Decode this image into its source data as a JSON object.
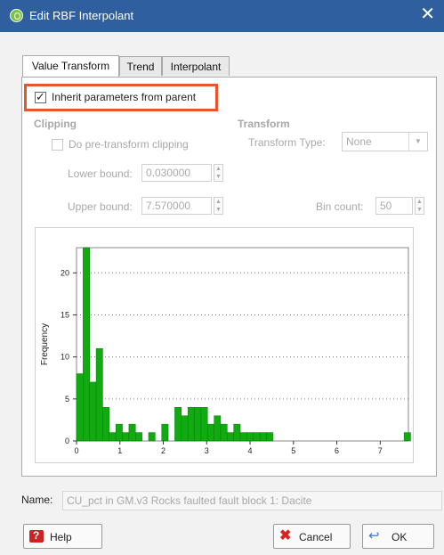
{
  "window": {
    "title": "Edit RBF Interpolant",
    "close_glyph": "✕"
  },
  "tabs": [
    "Value Transform",
    "Trend",
    "Interpolant"
  ],
  "inherit": {
    "label": "Inherit parameters from parent",
    "checked": true
  },
  "clipping": {
    "heading": "Clipping",
    "pre_transform_label": "Do pre-transform clipping",
    "lower_label": "Lower bound:",
    "lower_value": "0.030000",
    "upper_label": "Upper bound:",
    "upper_value": "7.570000"
  },
  "transform": {
    "heading": "Transform",
    "type_label": "Transform Type:",
    "type_value": "None",
    "bin_label": "Bin count:",
    "bin_value": "50"
  },
  "chart_data": {
    "type": "bar",
    "ylabel": "Frequency",
    "xlim": [
      0,
      7.65
    ],
    "ylim": [
      0,
      23
    ],
    "xticks": [
      0,
      1,
      2,
      3,
      4,
      5,
      6,
      7
    ],
    "yticks": [
      0,
      5,
      10,
      15,
      20
    ],
    "grid": "horizontal-dotted",
    "bar_color": "#11aa11",
    "bin_width": 0.151,
    "bin_starts": [
      0.0,
      0.151,
      0.302,
      0.453,
      0.604,
      0.755,
      0.906,
      1.057,
      1.208,
      1.359,
      1.51,
      1.661,
      1.812,
      1.963,
      2.114,
      2.265,
      2.416,
      2.567,
      2.718,
      2.869,
      3.02,
      3.171,
      3.322,
      3.473,
      3.624,
      3.775,
      3.926,
      4.077,
      4.228,
      4.379,
      4.53,
      7.55
    ],
    "values": [
      8,
      23,
      7,
      11,
      4,
      1,
      2,
      1,
      2,
      1,
      0,
      1,
      0,
      2,
      0,
      4,
      3,
      4,
      4,
      4,
      2,
      3,
      2,
      1,
      2,
      1,
      1,
      1,
      1,
      1,
      0,
      1
    ]
  },
  "name_field": {
    "label": "Name:",
    "value": "CU_pct in GM.v3 Rocks faulted fault block 1: Dacite"
  },
  "buttons": {
    "help": "Help",
    "cancel": "Cancel",
    "ok": "OK"
  }
}
